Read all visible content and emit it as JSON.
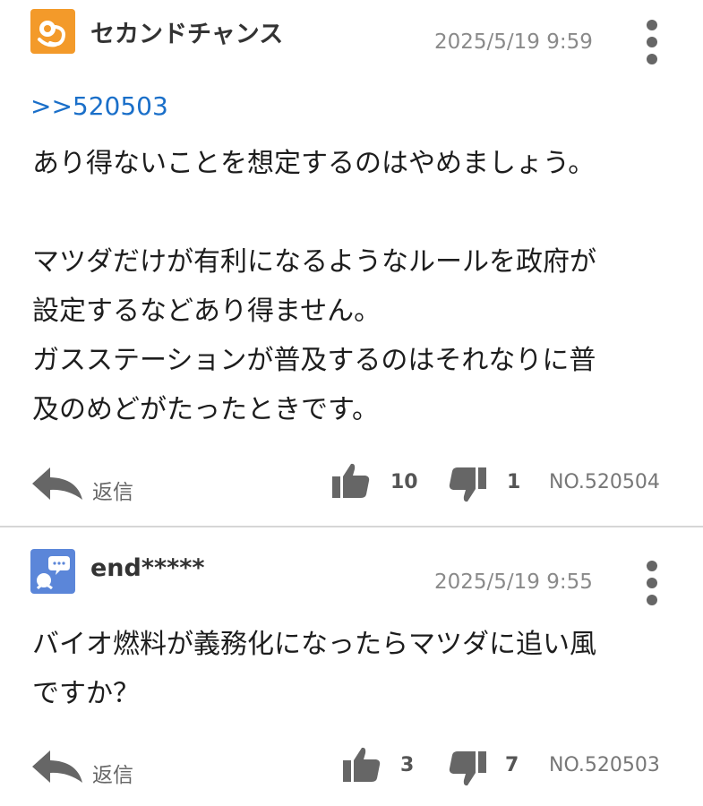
{
  "posts": [
    {
      "username": "セカンドチャンス",
      "timestamp": "2025/5/19 9:59",
      "anchor": ">>520503",
      "body": "あり得ないことを想定するのはやめましょう。\n\nマツダだけが有利になるようなルールを政府が\n設定するなどあり得ません。\nガスステーションが普及するのはそれなりに普\n及のめどがたったときです。",
      "reply_label": "返信",
      "likes": "10",
      "dislikes": "1",
      "post_no": "NO.520504",
      "avatar_color": "#f39a2a"
    },
    {
      "username": "end*****",
      "timestamp": "2025/5/19 9:55",
      "body": "バイオ燃料が義務化になったらマツダに追い風\nですか？",
      "reply_label": "返信",
      "likes": "3",
      "dislikes": "7",
      "post_no": "NO.520503",
      "avatar_color": "#5b86d9"
    }
  ],
  "colors": {
    "link": "#1a6fc9",
    "icon_gray": "#666666",
    "divider": "#d6d6d6"
  },
  "icons": {
    "menu": "vertical-ellipsis-icon",
    "reply": "reply-arrow-icon",
    "like": "thumbs-up-icon",
    "dislike": "thumbs-down-icon"
  }
}
